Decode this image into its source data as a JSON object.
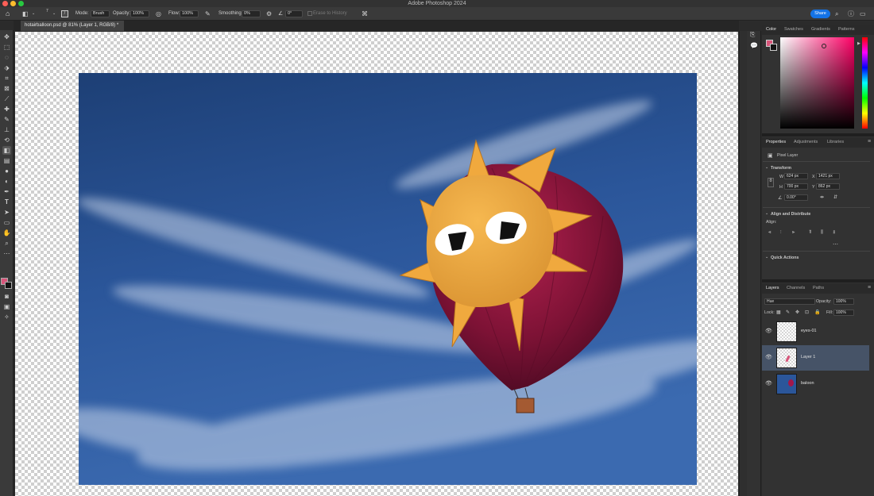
{
  "app": {
    "title": "Adobe Photoshop 2024"
  },
  "colors": {
    "accent": "#1473e6",
    "fg_swatch": "#d8557a",
    "bg_swatch": "#111111",
    "selected_layer": "#465367"
  },
  "options": {
    "mode_label": "Mode:",
    "mode_value": "Brush",
    "opacity_label": "Opacity:",
    "opacity_value": "100%",
    "flow_label": "Flow:",
    "flow_value": "100%",
    "smoothing_label": "Smoothing:",
    "smoothing_value": "0%",
    "angle_value": "0°",
    "erase_history": "Erase to History",
    "brush_size": "7",
    "share_label": "Share"
  },
  "document": {
    "tab_title": "hotairballoon.psd @ 81% (Layer 1, RGB/8) *"
  },
  "color_panel": {
    "tabs": [
      "Color",
      "Swatches",
      "Gradients",
      "Patterns"
    ]
  },
  "properties_panel": {
    "tabs": [
      "Properties",
      "Adjustments",
      "Libraries"
    ],
    "layer_type": "Pixel Layer",
    "transform_label": "Transform",
    "w_label": "W",
    "w_value": "624 px",
    "h_label": "H",
    "h_value": "700 px",
    "x_label": "X",
    "x_value": "1421 px",
    "y_label": "Y",
    "y_value": "862 px",
    "angle_value": "0.00°",
    "align_title": "Align and Distribute",
    "align_label": "Align:",
    "quick_actions": "Quick Actions"
  },
  "layers_panel": {
    "tabs": [
      "Layers",
      "Channels",
      "Paths"
    ],
    "blend_mode": "Hue",
    "opacity_label": "Opacity:",
    "opacity_value": "100%",
    "lock_label": "Lock:",
    "fill_label": "Fill:",
    "fill_value": "100%",
    "layers": [
      {
        "name": "eyes-01",
        "selected": false
      },
      {
        "name": "Layer 1",
        "selected": true
      },
      {
        "name": "baloon",
        "selected": false
      }
    ]
  }
}
